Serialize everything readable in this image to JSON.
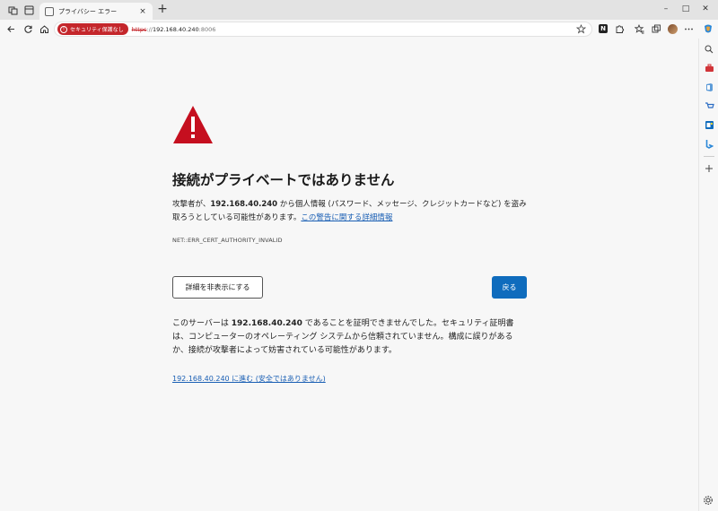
{
  "tab": {
    "title": "プライバシー エラー",
    "close": "×"
  },
  "new_tab": "+",
  "window_controls": {
    "minimize": "–",
    "maximize": "□",
    "close": "✕"
  },
  "address_bar": {
    "security_badge": "セキュリティ保護なし",
    "url_protocol": "https",
    "url_separator": "://",
    "url_host": "192.168.40.240",
    "url_port": ":8006"
  },
  "toolbar": {
    "n_badge": "N"
  },
  "page": {
    "heading": "接続がプライベートではありません",
    "para1_prefix": "攻撃者が、",
    "para1_host": "192.168.40.240",
    "para1_suffix": " から個人情報 (パスワード、メッセージ、クレジットカードなど) を盗み取ろうとしている可能性があります。",
    "warning_link": "この警告に関する詳細情報",
    "error_code": "NET::ERR_CERT_AUTHORITY_INVALID",
    "hide_details_button": "詳細を非表示にする",
    "back_button": "戻る",
    "para2_prefix": "このサーバーは ",
    "para2_host": "192.168.40.240",
    "para2_suffix": " であることを証明できませんでした。セキュリティ証明書は、コンピューターのオペレーティング システムから信頼されていません。構成に誤りがあるか、接続が攻撃者によって妨害されている可能性があります。",
    "proceed_link": "192.168.40.240 に進む (安全ではありません)"
  },
  "colors": {
    "accent_blue": "#0f6cbd",
    "warning_red": "#c4262b",
    "link_blue": "#1a5fb4"
  },
  "sidebar_icons": [
    "search-icon",
    "toolbox-icon",
    "office-icon",
    "shopping-icon",
    "outlook-icon",
    "bing-icon",
    "add-icon"
  ]
}
